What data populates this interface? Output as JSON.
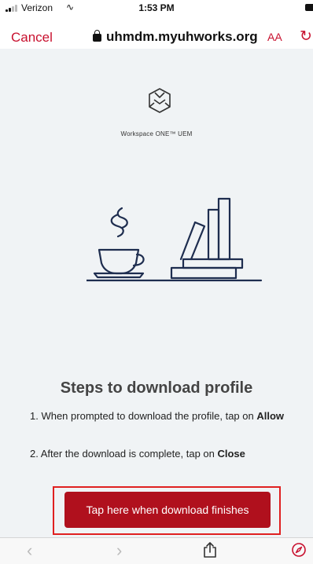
{
  "status_bar": {
    "carrier": "Verizon",
    "time": "1:53 PM"
  },
  "browser": {
    "cancel_label": "Cancel",
    "url": "uhmdm.myuhworks.org",
    "text_size_label": "AA"
  },
  "brand": {
    "name": "Workspace ONE™ UEM"
  },
  "content": {
    "heading": "Steps to download profile",
    "step1_text": "1. When prompted to download the profile, tap on ",
    "step1_bold": "Allow",
    "step2_text": "2. After the download is complete, tap on ",
    "step2_bold": "Close",
    "button_label": "Tap here when download finishes"
  },
  "colors": {
    "accent": "#c8102e",
    "button": "#b0101d",
    "background": "#f0f3f5",
    "illustration": "#1e2d4f"
  },
  "icons": [
    "wifi-icon",
    "battery-icon",
    "lock-icon",
    "reload-icon",
    "back-icon",
    "forward-icon",
    "share-icon",
    "safari-compass-icon"
  ]
}
